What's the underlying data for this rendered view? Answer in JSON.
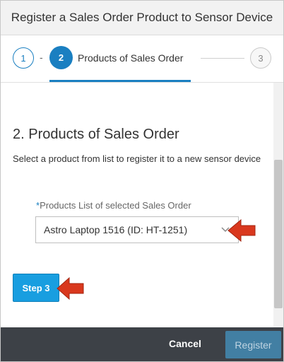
{
  "dialog": {
    "title": "Register a Sales Order Product to Sensor Device"
  },
  "wizard": {
    "steps": [
      {
        "number": "1"
      },
      {
        "number": "2",
        "title": "Products of Sales Order"
      },
      {
        "number": "3"
      }
    ],
    "separator": "-"
  },
  "content": {
    "section_title": "2. Products of Sales Order",
    "description": "Select a product from list to register it to a new sensor device",
    "field": {
      "required_marker": "*",
      "label": "Products List of selected Sales Order",
      "selected_value": "Astro Laptop 1516 (ID: HT-1251)"
    },
    "next_step_button": "Step 3"
  },
  "footer": {
    "cancel_label": "Cancel",
    "register_label": "Register"
  },
  "colors": {
    "accent": "#1a7fc1",
    "button_blue": "#189ee0",
    "footer_bg": "#3d4147",
    "arrow_red": "#d9381e"
  },
  "icons": {
    "select_chevron": "chevron-down-icon",
    "pointer_arrow": "red-arrow-icon"
  }
}
